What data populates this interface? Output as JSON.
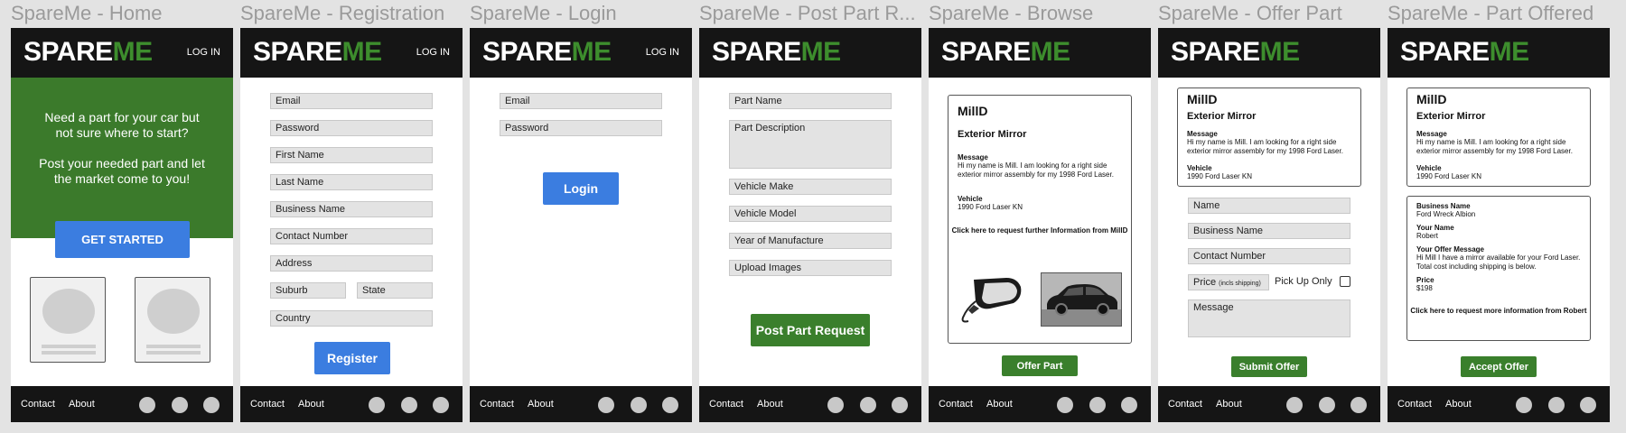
{
  "brand": {
    "spare": "SPARE",
    "me": "ME",
    "accent_green": "#3d8d2d",
    "button_blue": "#3b7de0",
    "button_green": "#3a7f2c"
  },
  "header": {
    "login_label": "LOG IN"
  },
  "footer": {
    "contact": "Contact",
    "about": "About"
  },
  "screens": [
    {
      "title": "SpareMe - Home"
    },
    {
      "title": "SpareMe - Registration"
    },
    {
      "title": "SpareMe - Login"
    },
    {
      "title": "SpareMe - Post Part R..."
    },
    {
      "title": "SpareMe - Browse"
    },
    {
      "title": "SpareMe - Offer Part"
    },
    {
      "title": "SpareMe - Part Offered"
    }
  ],
  "home": {
    "line1": "Need a part for your car but not sure where to start?",
    "line2": "Post your needed part and let the market come to you!",
    "cta": "GET STARTED"
  },
  "registration": {
    "fields": [
      "Email",
      "Password",
      "First Name",
      "Last Name",
      "Business Name",
      "Contact Number",
      "Address"
    ],
    "suburb": "Suburb",
    "state": "State",
    "country": "Country",
    "submit": "Register"
  },
  "login": {
    "email": "Email",
    "password": "Password",
    "submit": "Login"
  },
  "post": {
    "part_name": "Part Name",
    "part_description": "Part Description",
    "fields": [
      "Vehicle Make",
      "Vehicle Model",
      "Year of Manufacture",
      "Upload Images"
    ],
    "submit": "Post Part Request"
  },
  "request": {
    "user": "MillD",
    "part": "Exterior Mirror",
    "message_label": "Message",
    "message": "Hi my name is Mill. I am looking for a right side exterior mirror assembly for my 1998 Ford Laser.",
    "vehicle_label": "Vehicle",
    "vehicle": "1990 Ford Laser KN"
  },
  "browse": {
    "info_link": "Click here to request further Information from MillD",
    "offer_button": "Offer Part"
  },
  "offer": {
    "name": "Name",
    "business": "Business Name",
    "contact": "Contact Number",
    "price": "Price",
    "price_note": "(incls shipping)",
    "pickup": "Pick Up Only",
    "message": "Message",
    "submit": "Submit Offer"
  },
  "offered": {
    "business_label": "Business Name",
    "business": "Ford Wreck Albion",
    "name_label": "Your Name",
    "name": "Robert",
    "message_label": "Your Offer Message",
    "message": "Hi Mill I have a mirror available for your Ford Laser. Total cost including shipping is below.",
    "price_label": "Price",
    "price": "$198",
    "info_link": "Click here to request more information from Robert",
    "accept": "Accept Offer"
  }
}
